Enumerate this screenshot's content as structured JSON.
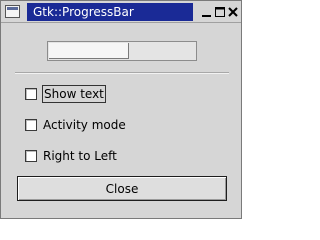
{
  "window": {
    "title": "Gtk::ProgressBar",
    "controls": {
      "minimize_icon": "minimize-icon",
      "maximize_icon": "maximize-icon",
      "close_icon": "close-window-icon"
    }
  },
  "progress": {
    "fraction": 0.55,
    "show_text": false
  },
  "options": {
    "show_text_label": "Show text",
    "show_text_checked": false,
    "activity_mode_label": "Activity mode",
    "activity_mode_checked": false,
    "right_to_left_label": "Right to Left",
    "right_to_left_checked": false
  },
  "buttons": {
    "close_label": "Close"
  },
  "colors": {
    "title_bar_active": "#1a2a96",
    "window_bg": "#d6d6d6"
  }
}
